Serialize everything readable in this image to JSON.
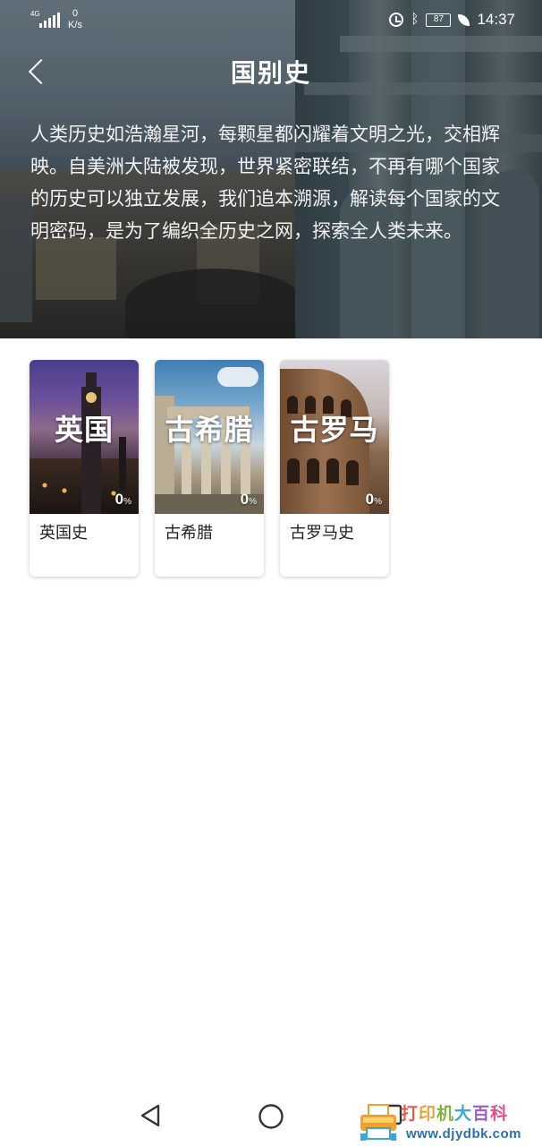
{
  "status_bar": {
    "network": "4G",
    "speed_value": "0",
    "speed_unit": "K/s",
    "battery": "87",
    "time": "14:37"
  },
  "header": {
    "title": "国别史"
  },
  "intro": "人类历史如浩瀚星河，每颗星都闪耀着文明之光，交相辉映。自美洲大陆被发现，世界紧密联结，不再有哪个国家的历史可以独立发展，我们追本溯源，解读每个国家的文明密码，是为了编织全历史之网，探索全人类未来。",
  "courses": [
    {
      "cover_title": "英国",
      "progress_value": "0",
      "progress_unit": "%",
      "name": "英国史"
    },
    {
      "cover_title": "古希腊",
      "progress_value": "0",
      "progress_unit": "%",
      "name": "古希腊"
    },
    {
      "cover_title": "古罗马",
      "progress_value": "0",
      "progress_unit": "%",
      "name": "古罗马史"
    }
  ],
  "nav": {
    "back_icon": "triangle-back-icon",
    "home_icon": "circle-home-icon",
    "recent_icon": "square-recent-icon"
  },
  "watermark": {
    "chars": [
      "打",
      "印",
      "机",
      "大",
      "百",
      "科"
    ],
    "url": "www.djydbk.com"
  }
}
